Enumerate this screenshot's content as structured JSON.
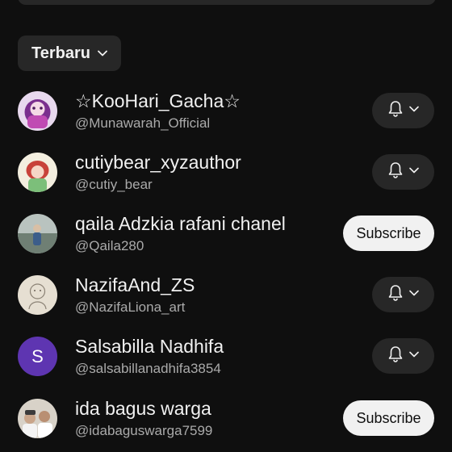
{
  "sort": {
    "label": "Terbaru",
    "icon": "chevron-down-icon"
  },
  "channels": [
    {
      "name": "☆KooHari_Gacha☆",
      "handle": "@Munawarah_Official",
      "action": "bell",
      "avatar": "avatar-image"
    },
    {
      "name": "cutiybear_xyzauthor",
      "handle": "@cutiy_bear",
      "action": "bell",
      "avatar": "avatar-image"
    },
    {
      "name": "qaila Adzkia rafani chanel",
      "handle": "@Qaila280",
      "action": "subscribe",
      "avatar": "avatar-image"
    },
    {
      "name": "NazifaAnd_ZS",
      "handle": "@NazifaLiona_art",
      "action": "bell",
      "avatar": "avatar-image"
    },
    {
      "name": "Salsabilla Nadhifa",
      "handle": "@salsabillanadhifa3854",
      "action": "bell",
      "avatar": "letter",
      "avatar_letter": "S",
      "avatar_color": "#5e35b1"
    },
    {
      "name": "ida bagus warga",
      "handle": "@idabaguswarga7599",
      "action": "subscribe",
      "avatar": "avatar-image"
    }
  ],
  "subscribe_label": "Subscribe",
  "colors": {
    "background": "#0f0f0f",
    "chip": "#272727",
    "text_primary": "#f1f1f1",
    "text_secondary": "#aaaaaa",
    "subscribe_bg": "#f1f1f1"
  }
}
